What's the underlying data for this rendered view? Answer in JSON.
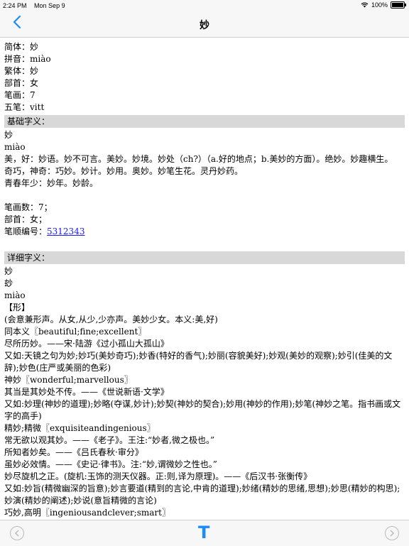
{
  "status": {
    "time": "2:24 PM",
    "date": "Mon Sep 9",
    "battery": "100%",
    "wifi_icon": "wifi-icon"
  },
  "nav": {
    "title": "妙",
    "back_icon": "chevron-left-icon"
  },
  "basic": [
    {
      "label": "简体：",
      "value": "妙"
    },
    {
      "label": "拼音：",
      "value": "miào"
    },
    {
      "label": "繁体：",
      "value": "妙"
    },
    {
      "label": "部首：",
      "value": "女"
    },
    {
      "label": "笔画：",
      "value": "7"
    },
    {
      "label": "五笔：",
      "value": "vitt"
    }
  ],
  "section1": {
    "header": "基础字义：",
    "char": "妙",
    "pinyin": "miào",
    "lines": [
      "美，好：妙语。妙不可言。美妙。妙境。妙处（ch?）（a.好的地点；b.美妙的方面）。绝妙。妙趣横生。",
      "奇巧，神奇：巧妙。妙计。妙用。奥妙。妙笔生花。灵丹妙药。",
      "青春年少：妙年。妙龄。"
    ],
    "stroke_count": "笔画数：7；",
    "radical": "部首：女；",
    "order_label": "笔顺编号：",
    "order_value": "5312343"
  },
  "section2": {
    "header": "详细字义：",
    "lines": [
      "妙",
      "玅",
      "miào",
      "【形】",
      "(会意兼形声。从女,从少,少亦声。美妙少女。本义:美,好)",
      "同本义〖beautiful;fine;excellent〗",
      "尽所历妙。——宋·陆游《过小孤山大孤山》",
      "又如:天镜之句为妙;妙巧(美妙奇巧);妙香(特好的香气);妙丽(容貌美好);妙观(美妙的观察);妙引(佳美的文辞);妙色(庄严或美丽的色彩)",
      "神妙〖wonderful;marvellous〗",
      "其当是其妙处不传。——《世说新语·文学》",
      "又如:妙理(神妙的道理);妙略(夺谋,妙计);妙契(神妙的契合);妙用(神妙的作用);妙笔(神妙之笔。指书画或文字的高手)",
      "精妙;精微〖exquisiteandingenious〗",
      "常无欲以观其妙。——《老子》。王注:“妙者,微之极也。”",
      "所知者妙矣。——《吕氏春秋·审分》",
      "虽妙必效情。——《史记·律书》。注:“妙,谓微妙之性也。”",
      "妙尽旋机之正。(旋机:玉饰的测天仪器。正:则,译为原理)。——《后汉书·张衡传》",
      "又如:妙旨(精微幽深的旨意);妙言要道(精到的言论,中肯的道理);妙绪(精妙的思绪,思想);妙思(精妙的构思);妙演(精妙的阐述);妙说(意旨精微的言论)",
      "巧妙,高明〖ingeniousandclever;smart〗"
    ]
  },
  "toolbar": {
    "prev_icon": "chevron-left-circle-icon",
    "font_button": "T",
    "next_icon": "chevron-right-circle-icon"
  }
}
